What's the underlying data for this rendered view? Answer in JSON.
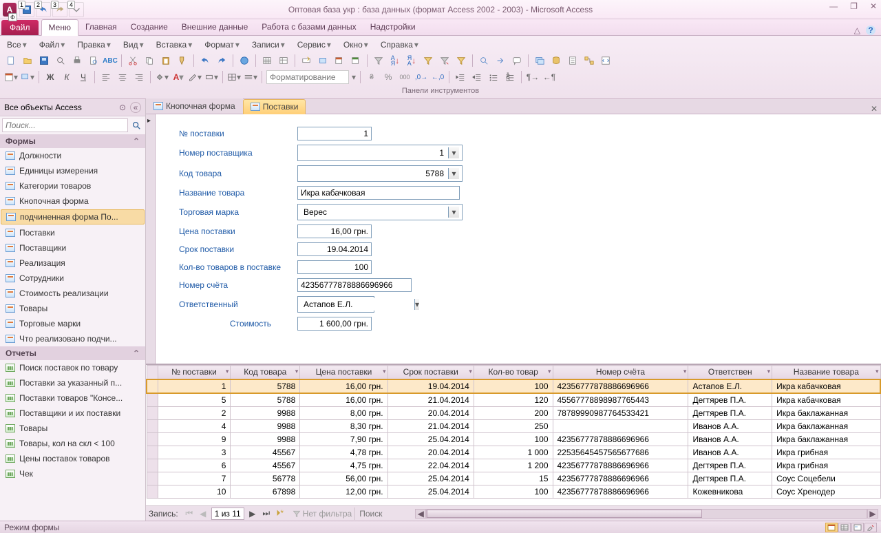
{
  "title": "Оптовая база укр : база данных (формат Access 2002 - 2003) - Microsoft Access",
  "qat_badges": [
    "Ф",
    "1",
    "2",
    "3",
    "4"
  ],
  "file_tab": {
    "label": "Файл",
    "badge": "Ф"
  },
  "ribbon_tabs": [
    "Меню",
    "Главная",
    "Создание",
    "Внешние данные",
    "Работа с базами данных",
    "Надстройки"
  ],
  "menu_row": [
    {
      "label": "Все",
      "dd": true
    },
    {
      "label": "Файл",
      "dd": true
    },
    {
      "label": "Правка",
      "dd": true
    },
    {
      "label": "Вид",
      "dd": true
    },
    {
      "label": "Вставка",
      "dd": true
    },
    {
      "label": "Формат",
      "dd": true
    },
    {
      "label": "Записи",
      "dd": true
    },
    {
      "label": "Сервис",
      "dd": true
    },
    {
      "label": "Окно",
      "dd": true
    },
    {
      "label": "Справка",
      "dd": true
    }
  ],
  "ribbon_group_label": "Панели инструментов",
  "format_placeholder": "Форматирование",
  "nav_pane": {
    "title": "Все объекты Access",
    "search_placeholder": "Поиск...",
    "sections": [
      {
        "title": "Формы",
        "type": "form",
        "items": [
          "Должности",
          "Единицы измерения",
          "Категории товаров",
          "Кнопочная форма",
          "подчиненная форма По...",
          "Поставки",
          "Поставщики",
          "Реализация",
          "Сотрудники",
          "Стоимость реализации",
          "Товары",
          "Торговые марки",
          "Что реализовано подчи..."
        ],
        "selected_index": 4
      },
      {
        "title": "Отчеты",
        "type": "report",
        "items": [
          "Поиск поставок по товару",
          "Поставки за указанный п...",
          "Поставки товаров \"Консе...",
          "Поставщики и их поставки",
          "Товары",
          "Товары, кол на скл < 100",
          "Цены поставок товаров",
          "Чек"
        ]
      }
    ],
    "bottom_hint": ""
  },
  "doc_tabs": [
    {
      "label": "Кнопочная форма",
      "active": false
    },
    {
      "label": "Поставки",
      "active": true
    }
  ],
  "form": {
    "labels": {
      "num": "№ поставки",
      "supplier_num": "Номер поставщика",
      "prod_code": "Код товара",
      "prod_name": "Название товара",
      "brand": "Торговая марка",
      "price": "Цена поставки",
      "date": "Срок поставки",
      "qty": "Кол-во товаров в поставке",
      "account": "Номер счёта",
      "responsible": "Ответственный",
      "total": "Стоимость"
    },
    "values": {
      "num": "1",
      "supplier_num": "1",
      "prod_code": "5788",
      "prod_name": "Икра кабачковая",
      "brand": "Верес",
      "price": "16,00 грн.",
      "date": "19.04.2014",
      "qty": "100",
      "account": "42356777878886696966",
      "responsible": "Астапов Е.Л.",
      "total": "1 600,00 грн."
    }
  },
  "subform": {
    "columns": [
      "№ поставки",
      "Код товара",
      "Цена поставки",
      "Срок поставки",
      "Кол-во товар",
      "Номер счёта",
      "Ответствен",
      "Название товара"
    ],
    "rows": [
      {
        "num": "1",
        "code": "5788",
        "price": "16,00 грн.",
        "date": "19.04.2014",
        "qty": "100",
        "acc": "42356777878886696966",
        "resp": "Астапов Е.Л.",
        "name": "Икра кабачковая",
        "selected": true
      },
      {
        "num": "5",
        "code": "5788",
        "price": "16,00 грн.",
        "date": "21.04.2014",
        "qty": "120",
        "acc": "45567778898987765443",
        "resp": "Дегтярев П.А.",
        "name": "Икра кабачковая"
      },
      {
        "num": "2",
        "code": "9988",
        "price": "8,00 грн.",
        "date": "20.04.2014",
        "qty": "200",
        "acc": "78789990987764533421",
        "resp": "Дегтярев П.А.",
        "name": "Икра баклажанная"
      },
      {
        "num": "4",
        "code": "9988",
        "price": "8,30 грн.",
        "date": "21.04.2014",
        "qty": "250",
        "acc": "",
        "resp": "Иванов А.А.",
        "name": "Икра баклажанная"
      },
      {
        "num": "9",
        "code": "9988",
        "price": "7,90 грн.",
        "date": "25.04.2014",
        "qty": "100",
        "acc": "42356777878886696966",
        "resp": "Иванов А.А.",
        "name": "Икра баклажанная"
      },
      {
        "num": "3",
        "code": "45567",
        "price": "4,78 грн.",
        "date": "20.04.2014",
        "qty": "1 000",
        "acc": "22535645457565677686",
        "resp": "Иванов А.А.",
        "name": "Икра грибная"
      },
      {
        "num": "6",
        "code": "45567",
        "price": "4,75 грн.",
        "date": "22.04.2014",
        "qty": "1 200",
        "acc": "42356777878886696966",
        "resp": "Дегтярев П.А.",
        "name": "Икра грибная"
      },
      {
        "num": "7",
        "code": "56778",
        "price": "56,00 грн.",
        "date": "25.04.2014",
        "qty": "15",
        "acc": "42356777878886696966",
        "resp": "Дегтярев П.А.",
        "name": "Соус Соцебели"
      },
      {
        "num": "10",
        "code": "67898",
        "price": "12,00 грн.",
        "date": "25.04.2014",
        "qty": "100",
        "acc": "42356777878886696966",
        "resp": "Кожевникова",
        "name": "Соус Хренодер"
      }
    ],
    "nav": {
      "label": "Запись:",
      "pos": "1 из 11",
      "filter": "Нет фильтра",
      "search": "Поиск"
    }
  },
  "status_bar": {
    "mode": "Режим формы"
  }
}
